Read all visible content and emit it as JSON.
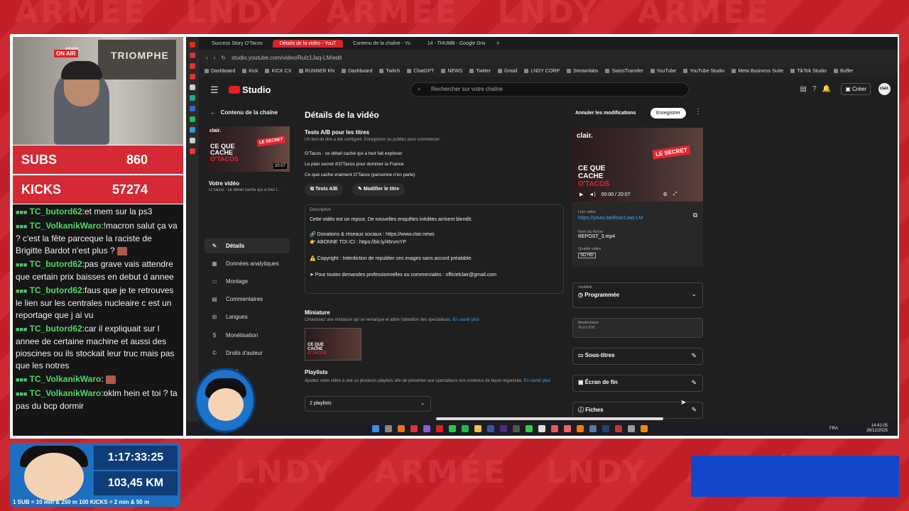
{
  "stream": {
    "subs_label": "SUBS",
    "subs_value": "860",
    "kicks_label": "KICKS",
    "kicks_value": "57274",
    "poster_text": "TRIOMPHE",
    "brand_text": "clair.",
    "onair_text": "ON AIR",
    "timer": "1:17:33:25",
    "distance": "103,45 KM",
    "rule": "1 SUB = 10 min & 250 m     100 KICKS = 2 min & 50 m",
    "chat": [
      {
        "user": "TC_butord62",
        "text": ":et mem sur la ps3"
      },
      {
        "user": "TC_VolkanikWaro",
        "text": ":!macron salut ça va ? c'est la fête parceque la raciste de Brigitte Bardot n'est plus ?"
      },
      {
        "user": "TC_butord62",
        "text": ":pas grave vais attendre que certain prix baisses en debut d annee"
      },
      {
        "user": "TC_butord62",
        "text": ":faus que je te retrouves le lien sur les centrales nucleaire c est un reportage que j ai vu"
      },
      {
        "user": "TC_butord62",
        "text": ":car il expliquait sur l annee de certaine machine et aussi des pioscines ou ils stockait leur truc mais pas que les notres"
      },
      {
        "user": "TC_VolkanikWaro",
        "text": ":"
      },
      {
        "user": "TC_VolkanikWaro",
        "text": ":oklm hein et toi ? ta pas du bcp dormir"
      }
    ]
  },
  "browser": {
    "tabs": [
      {
        "label": "Success Story O'Tacos"
      },
      {
        "label": "Détails de la vidéo - YouT"
      },
      {
        "label": "Contenu de la chaîne - Yo"
      },
      {
        "label": "14 - THUMB - Google Driv"
      }
    ],
    "url": "studio.youtube.com/video/Rulz1Jaq-LM/edit",
    "bookmarks": [
      "Dashboard",
      "Kick",
      "KICK CX",
      "RUNNER KN",
      "Dashboard",
      "Twitch",
      "ChatGPT",
      "NEWS",
      "Twitter",
      "Gmail",
      "LNDY CORP",
      "Streamlabs",
      "SwissTransfer",
      "YouTube",
      "YouTube Studio",
      "Meta Business Suite",
      "TikTok Studio",
      "Buffer"
    ]
  },
  "studio": {
    "logo": "Studio",
    "search_placeholder": "Rechercher sur votre chaîne",
    "create": "Créer",
    "avatar": "clair.",
    "back": "Contenu de la chaîne",
    "your_video": "Votre vidéo",
    "your_video_sub": "O'Tacos : ce détail caché qui a tout f...",
    "thumb_title_1": "CE QUE",
    "thumb_title_2": "CACHE",
    "thumb_title_3": "O'TACOS",
    "thumb_badge": "LE SECRET",
    "thumb_duration": "20:07",
    "nav": [
      "Détails",
      "Données analytiques",
      "Montage",
      "Commentaires",
      "Langues",
      "Monétisation",
      "Droits d'auteur",
      "Clips"
    ],
    "page_title": "Détails de la vidéo",
    "ab_title": "Tests A/B pour les titres",
    "ab_sub": "Un test de titre a été configuré. Enregistrez ou publiez pour commencer.",
    "ab_titles": [
      "O'Tacos : ce détail caché qui a tout fait exploser",
      "Le plan secret d'O'Tacos pour dominer la France",
      "Ce que cache vraiment O'Tacos (personne n'en parle)"
    ],
    "ab_button": "Tests A/B",
    "edit_title_button": "Modifier le titre",
    "description_label": "Description",
    "description_lines": [
      "Cette vidéo est un repost. De nouvelles enquêtes inédites arrivent bientôt.",
      "🔗 Donations & réseaux sociaux : https://www.clair.news",
      "👉 ABONNE TOI ICI : https://bit.ly/46rvmYP",
      "⚠️ Copyright : Interdiction de republier ces images sans accord préalable.",
      "➤ Pour toutes demandes professionnelles ou commerciales : officielclair@gmail.com"
    ],
    "miniature_title": "Miniature",
    "miniature_sub": "Choisissez une miniature qui se remarque et attire l'attention des spectateurs.",
    "miniature_link": "En savoir plus",
    "playlists_title": "Playlists",
    "playlists_sub": "Ajoutez votre vidéo à une ou plusieurs playlists afin de présenter aux spectateurs vos contenus de façon organisée.",
    "playlists_link": "En savoir plus",
    "playlists_value": "2 playlists",
    "cancel_button": "Annuler les modifications",
    "save_button": "Enregistrer",
    "player_time": "00:00 / 20:07",
    "link_label": "Lien vidéo",
    "link_value": "https://youtu.be/Rulz1Jaq-LM",
    "file_label": "Nom du fichier",
    "file_value": "REPOST_3.mp4",
    "quality_label": "Qualité vidéo",
    "quality_value": "SD HD",
    "visibility_label": "Visibilité",
    "visibility_value": "Programmée",
    "restrictions_label": "Restrictions",
    "restrictions_value": "Aucune",
    "subtitles": "Sous-titres",
    "endscreen": "Écran de fin",
    "cards": "Fiches"
  },
  "taskbar": {
    "lang": "FRA",
    "time": "14:41:05",
    "date": "28/12/2025"
  },
  "colors": {
    "accent_red": "#d7252e",
    "link_blue": "#3ea6ff",
    "stream_blue": "#1d6fbf"
  }
}
